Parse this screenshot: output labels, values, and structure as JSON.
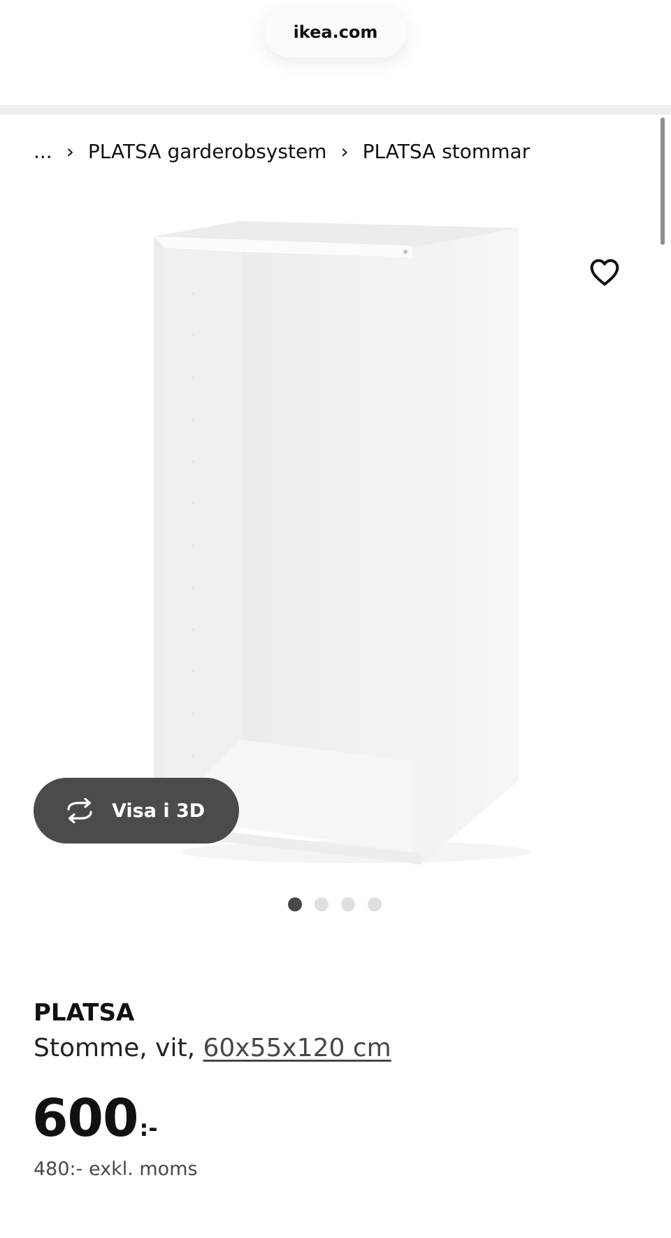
{
  "browser": {
    "url": "ikea.com"
  },
  "breadcrumb": {
    "ellipsis": "...",
    "items": [
      "PLATSA garderobsystem",
      "PLATSA stommar"
    ]
  },
  "product": {
    "name": "PLATSA",
    "description_prefix": "Stomme, vit,",
    "dimensions": "60x55x120 cm",
    "price": "600",
    "price_suffix": ":-",
    "price_exkl_moms": "480:- exkl. moms"
  },
  "media": {
    "view_3d_label": "Visa i 3D",
    "gallery_count": 4,
    "gallery_active_index": 0
  },
  "icons": {
    "favorite": "heart-icon",
    "rotate_3d": "rotate-3d-icon"
  },
  "colors": {
    "button_3d_bg": "#4b4b4b",
    "dot_active": "#484848",
    "dot_inactive": "#dfdfdf"
  }
}
